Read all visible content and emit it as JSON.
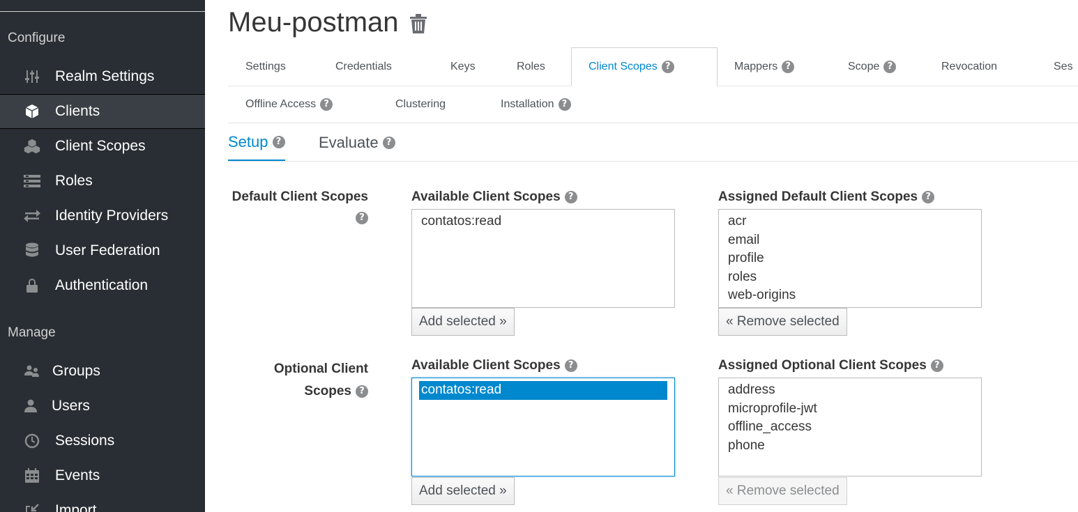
{
  "sidebar": {
    "configure_label": "Configure",
    "manage_label": "Manage",
    "configure_items": [
      {
        "label": "Realm Settings",
        "icon": "sliders-icon"
      },
      {
        "label": "Clients",
        "icon": "cube-icon"
      },
      {
        "label": "Client Scopes",
        "icon": "cubes-icon"
      },
      {
        "label": "Roles",
        "icon": "list-icon"
      },
      {
        "label": "Identity Providers",
        "icon": "exchange-icon"
      },
      {
        "label": "User Federation",
        "icon": "database-icon"
      },
      {
        "label": "Authentication",
        "icon": "lock-icon"
      }
    ],
    "manage_items": [
      {
        "label": "Groups",
        "icon": "users-icon"
      },
      {
        "label": "Users",
        "icon": "user-icon"
      },
      {
        "label": "Sessions",
        "icon": "clock-icon"
      },
      {
        "label": "Events",
        "icon": "calendar-icon"
      },
      {
        "label": "Import",
        "icon": "import-icon"
      }
    ],
    "active_item": "Clients"
  },
  "page": {
    "title": "Meu-postman"
  },
  "tabs": {
    "row1": [
      {
        "label": "Settings",
        "help": false
      },
      {
        "label": "Credentials",
        "help": false
      },
      {
        "label": "Keys",
        "help": false
      },
      {
        "label": "Roles",
        "help": false
      },
      {
        "label": "Client Scopes",
        "help": true,
        "active": true
      },
      {
        "label": "Mappers",
        "help": true
      },
      {
        "label": "Scope",
        "help": true
      },
      {
        "label": "Revocation",
        "help": false
      },
      {
        "label": "Ses",
        "help": false
      }
    ],
    "row2": [
      {
        "label": "Offline Access",
        "help": true
      },
      {
        "label": "Clustering",
        "help": false
      },
      {
        "label": "Installation",
        "help": true
      }
    ]
  },
  "subtabs": [
    {
      "label": "Setup",
      "active": true
    },
    {
      "label": "Evaluate",
      "active": false
    }
  ],
  "default_scopes": {
    "row_label": "Default Client Scopes",
    "available_label": "Available Client Scopes",
    "assigned_label": "Assigned Default Client Scopes",
    "available": [
      "contatos:read"
    ],
    "assigned": [
      "acr",
      "email",
      "profile",
      "roles",
      "web-origins"
    ],
    "add_button": "Add selected »",
    "remove_button": "« Remove selected"
  },
  "optional_scopes": {
    "row_label_line1": "Optional Client",
    "row_label_line2": "Scopes",
    "available_label": "Available Client Scopes",
    "assigned_label": "Assigned Optional Client Scopes",
    "available": [
      "contatos:read"
    ],
    "available_selected": "contatos:read",
    "assigned": [
      "address",
      "microprofile-jwt",
      "offline_access",
      "phone"
    ],
    "add_button": "Add selected »",
    "remove_button": "« Remove selected"
  },
  "colors": {
    "sidebar_bg": "#292e34",
    "accent": "#0088ce"
  }
}
